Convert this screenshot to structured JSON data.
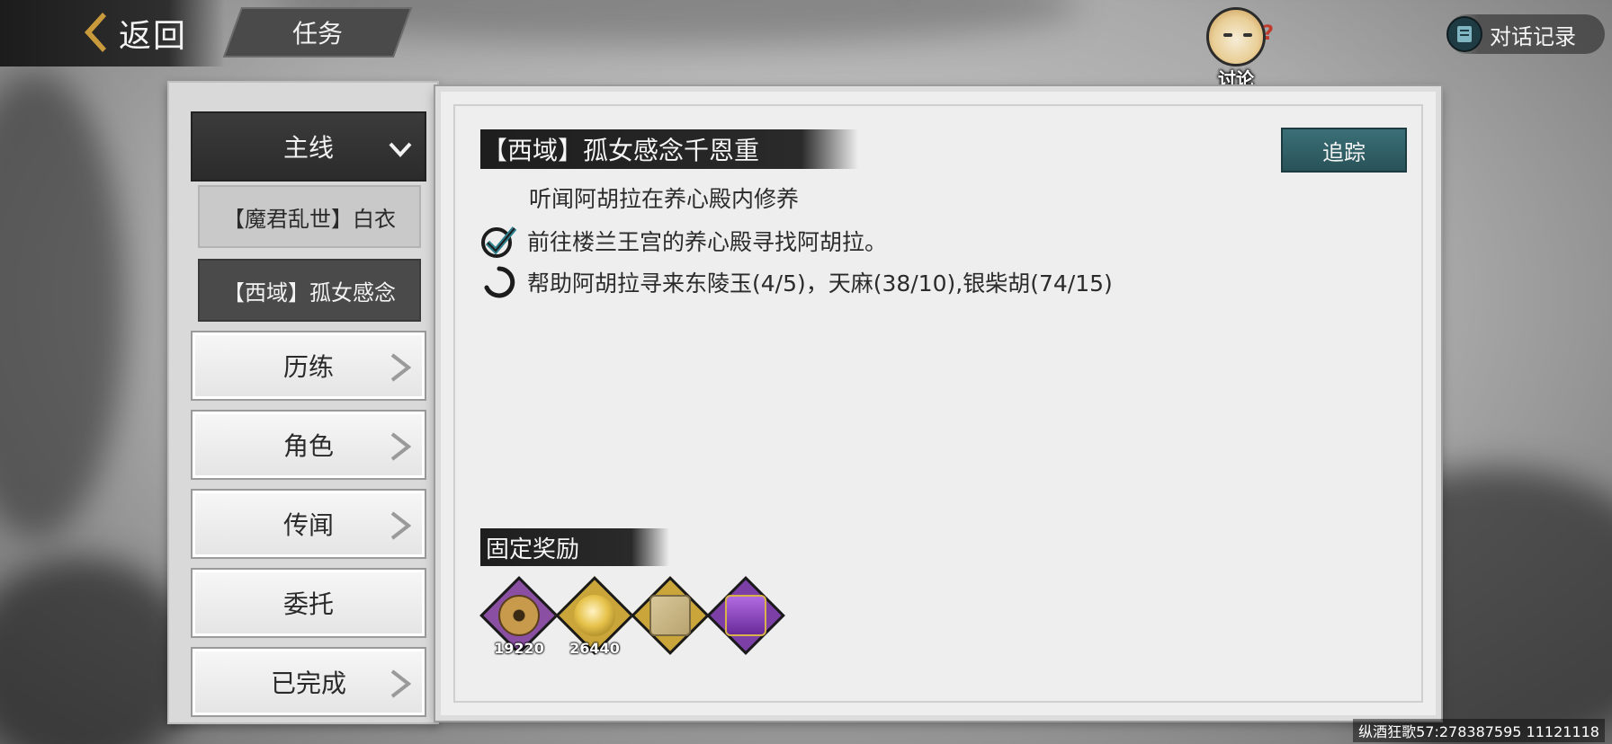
{
  "header": {
    "back_label": "返回",
    "title": "任务",
    "discuss_label": "讨论",
    "dialog_log_label": "对话记录"
  },
  "sidebar": {
    "categories": [
      {
        "label": "主线",
        "active": true
      },
      {
        "label": "历练"
      },
      {
        "label": "角色"
      },
      {
        "label": "传闻"
      },
      {
        "label": "委托"
      },
      {
        "label": "已完成"
      }
    ],
    "subitems": [
      {
        "label": "【魔君乱世】白衣",
        "selected": false
      },
      {
        "label": "【西域】孤女感念",
        "selected": true
      }
    ]
  },
  "quest": {
    "title": "【西域】孤女感念千恩重",
    "track_label": "追踪",
    "description": "听闻阿胡拉在养心殿内修养",
    "objectives": [
      {
        "status": "done",
        "text": "前往楼兰王宫的养心殿寻找阿胡拉。"
      },
      {
        "status": "in-progress",
        "text": "帮助阿胡拉寻来东陵玉(4/5)，天麻(38/10),银柴胡(74/15)"
      }
    ]
  },
  "rewards": {
    "title": "固定奖励",
    "items": [
      {
        "icon": "copper-coin-icon",
        "count": "19220",
        "frame_color": "#8a4fa3"
      },
      {
        "icon": "gold-orb-icon",
        "count": "26440",
        "frame_color": "#c9a53a"
      },
      {
        "icon": "map-scroll-icon",
        "count": "",
        "frame_color": "#c9a53a"
      },
      {
        "icon": "purple-chest-icon",
        "count": "",
        "frame_color": "#7b3fa6"
      }
    ]
  },
  "watermark": "纵酒狂歌57:278387595 11121118"
}
